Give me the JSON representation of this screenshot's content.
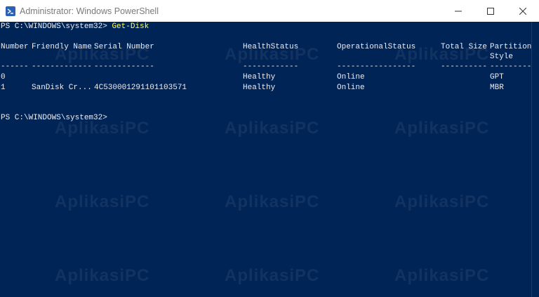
{
  "window": {
    "title": "Administrator: Windows PowerShell"
  },
  "console": {
    "prompt1": "PS C:\\WINDOWS\\system32> ",
    "command1": "Get-Disk",
    "headers": {
      "number": "Number",
      "friendly_name": "Friendly Name",
      "serial_number": "Serial Number",
      "health_status": "HealthStatus",
      "operational_status": "OperationalStatus",
      "total_size": "Total Size",
      "partition": "Partition",
      "partition_style": "Style"
    },
    "separators": {
      "number": "------",
      "friendly_name": "-------------",
      "serial_number": "-------------",
      "health_status": "------------",
      "operational_status": "-----------------",
      "total_size": "----------",
      "partition_style": "----------"
    },
    "rows": [
      {
        "number": "0",
        "friendly_name": "",
        "serial_number": "",
        "health_status": "Healthy",
        "operational_status": "Online",
        "total_size": "",
        "partition_style": "GPT"
      },
      {
        "number": "1",
        "friendly_name": "SanDisk Cr...",
        "serial_number": "4C530001291101103571",
        "health_status": "Healthy",
        "operational_status": "Online",
        "total_size": "",
        "partition_style": "MBR"
      }
    ],
    "prompt2": "PS C:\\WINDOWS\\system32>"
  },
  "watermark": {
    "text": "AplikasiPC"
  }
}
